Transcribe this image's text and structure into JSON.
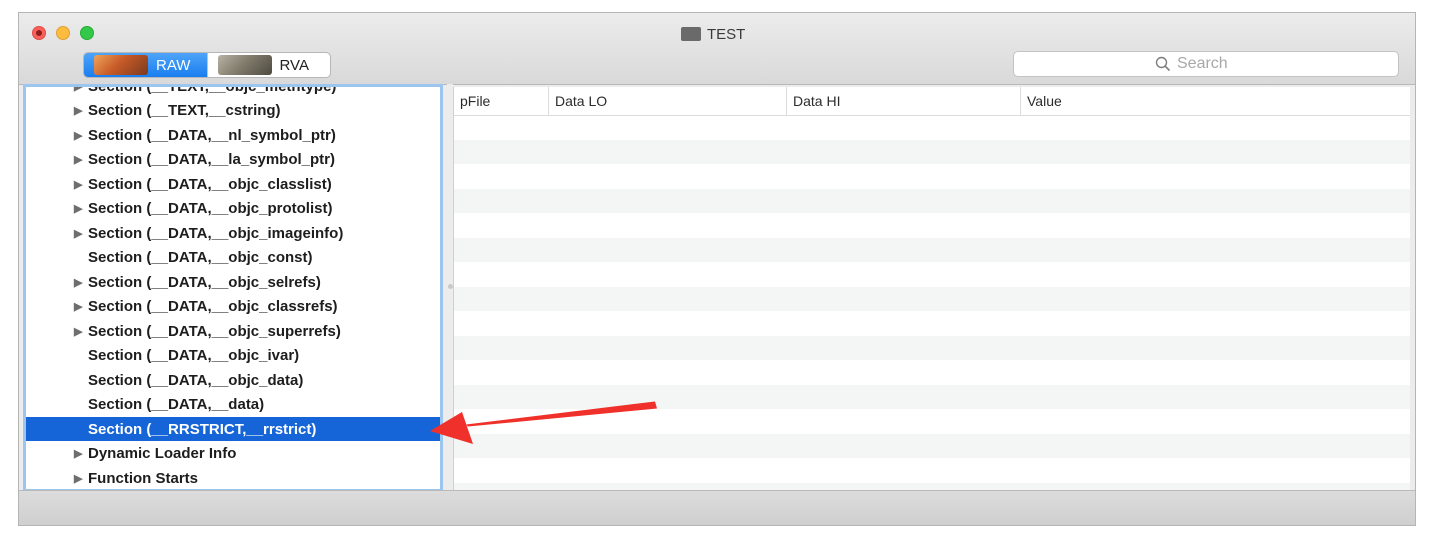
{
  "window": {
    "title": "TEST"
  },
  "toolbar": {
    "segments": [
      {
        "label": "RAW",
        "selected": true
      },
      {
        "label": "RVA",
        "selected": false
      }
    ],
    "search_placeholder": "Search"
  },
  "tree": {
    "items": [
      {
        "label": "Section (__TEXT,__objc_methtype)",
        "has_children": true,
        "selected": false
      },
      {
        "label": "Section (__TEXT,__cstring)",
        "has_children": true,
        "selected": false
      },
      {
        "label": "Section (__DATA,__nl_symbol_ptr)",
        "has_children": true,
        "selected": false
      },
      {
        "label": "Section (__DATA,__la_symbol_ptr)",
        "has_children": true,
        "selected": false
      },
      {
        "label": "Section (__DATA,__objc_classlist)",
        "has_children": true,
        "selected": false
      },
      {
        "label": "Section (__DATA,__objc_protolist)",
        "has_children": true,
        "selected": false
      },
      {
        "label": "Section (__DATA,__objc_imageinfo)",
        "has_children": true,
        "selected": false
      },
      {
        "label": "Section (__DATA,__objc_const)",
        "has_children": false,
        "selected": false
      },
      {
        "label": "Section (__DATA,__objc_selrefs)",
        "has_children": true,
        "selected": false
      },
      {
        "label": "Section (__DATA,__objc_classrefs)",
        "has_children": true,
        "selected": false
      },
      {
        "label": "Section (__DATA,__objc_superrefs)",
        "has_children": true,
        "selected": false
      },
      {
        "label": "Section (__DATA,__objc_ivar)",
        "has_children": false,
        "selected": false
      },
      {
        "label": "Section (__DATA,__objc_data)",
        "has_children": false,
        "selected": false
      },
      {
        "label": "Section (__DATA,__data)",
        "has_children": false,
        "selected": false
      },
      {
        "label": "Section (__RRSTRICT,__rrstrict)",
        "has_children": false,
        "selected": true
      },
      {
        "label": "Dynamic Loader Info",
        "has_children": true,
        "selected": false
      },
      {
        "label": "Function Starts",
        "has_children": true,
        "selected": false
      }
    ]
  },
  "table": {
    "columns": [
      "pFile",
      "Data LO",
      "Data HI",
      "Value"
    ],
    "rows": []
  },
  "colors": {
    "selection": "#1565d8",
    "annotation_arrow": "#f0302a",
    "focus_ring": "#9cc6f0"
  }
}
